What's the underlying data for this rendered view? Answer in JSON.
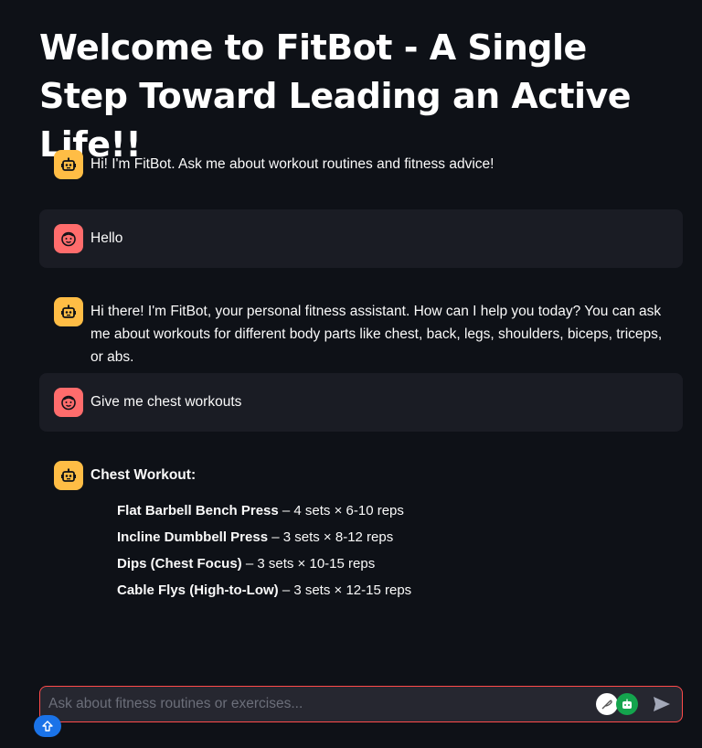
{
  "header": {
    "title": "Welcome to FitBot - A Single Step Toward Leading an Active Life!!"
  },
  "messages": [
    {
      "role": "assistant",
      "icon": "robot-icon",
      "text": "Hi! I'm FitBot. Ask me about workout routines and fitness advice!"
    },
    {
      "role": "user",
      "icon": "face-icon",
      "text": "Hello"
    },
    {
      "role": "assistant",
      "icon": "robot-icon",
      "text": "Hi there! I'm FitBot, your personal fitness assistant. How can I help you today? You can ask me about workouts for different body parts like chest, back, legs, shoulders, biceps, triceps, or abs."
    },
    {
      "role": "user",
      "icon": "face-icon",
      "text": "Give me chest workouts"
    },
    {
      "role": "assistant",
      "icon": "robot-icon",
      "heading": "Chest Workout:",
      "items": [
        {
          "name": "Flat Barbell Bench Press",
          "detail": " – 4 sets × 6-10 reps"
        },
        {
          "name": "Incline Dumbbell Press",
          "detail": " – 3 sets × 8-12 reps"
        },
        {
          "name": "Dips (Chest Focus)",
          "detail": " – 3 sets × 10-15 reps"
        },
        {
          "name": "Cable Flys (High-to-Low)",
          "detail": " – 3 sets × 12-15 reps"
        }
      ]
    }
  ],
  "chat_input": {
    "placeholder": "Ask about fitness routines or exercises...",
    "value": ""
  },
  "colors": {
    "background": "#0e1117",
    "user_bubble": "#1a1c24",
    "bot_avatar": "#ffbd45",
    "user_avatar": "#ff6c6c",
    "input_border": "#ff4b4b"
  }
}
